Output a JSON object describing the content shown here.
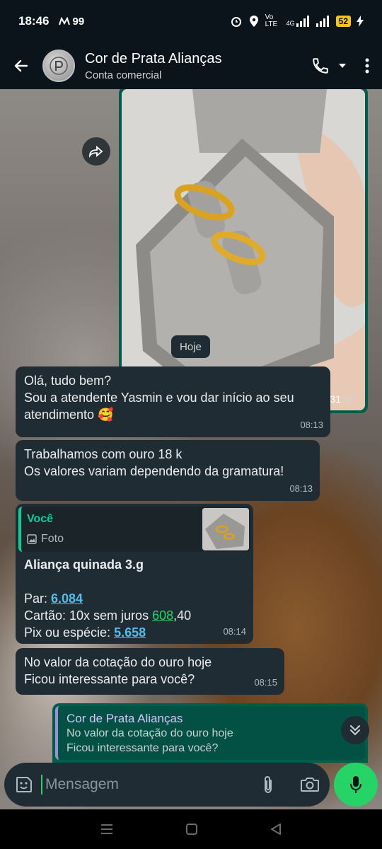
{
  "status_bar": {
    "time": "18:46",
    "carrier_badge": "99",
    "network": "Vo LTE",
    "signal": "4G",
    "battery": "52"
  },
  "header": {
    "contact_name": "Cor de Prata Alianças",
    "contact_subtitle": "Conta comercial"
  },
  "messages": {
    "image_time": "18:31",
    "date_chip": "Hoje",
    "greeting": {
      "lines": [
        "Olá, tudo bem?",
        "Sou a atendente Yasmin e vou dar início ao seu",
        "atendimento 🥰"
      ],
      "time": "08:13"
    },
    "gold_info": {
      "lines": [
        "Trabalhamos com ouro 18 k",
        "Os valores variam dependendo da gramatura!"
      ],
      "time": "08:13"
    },
    "product": {
      "quote_author": "Você",
      "quote_type": "Foto",
      "title": "Aliança quinada 3.g",
      "par_label": "Par: ",
      "par_value": "6.084",
      "card_label": "Cartão: 10x sem juros ",
      "card_value": "608",
      "card_cents": ",40",
      "pix_label": "Pix ou espécie: ",
      "pix_value": "5.658",
      "time": "08:14"
    },
    "quote_price": {
      "lines": [
        "No valor da cotação do ouro hoje",
        "Ficou interessante para você?"
      ],
      "time": "08:15"
    },
    "outgoing_reply": {
      "quote_author": "Cor de Prata Alianças",
      "quote_lines": [
        "No valor da cotação do ouro hoje",
        "Ficou interessante para você?"
      ]
    }
  },
  "input": {
    "placeholder": "Mensagem"
  },
  "colors": {
    "accent": "#25d366",
    "outgoing_bubble": "#005c4b",
    "incoming_bubble": "#202c33",
    "link": "#53bdeb"
  }
}
